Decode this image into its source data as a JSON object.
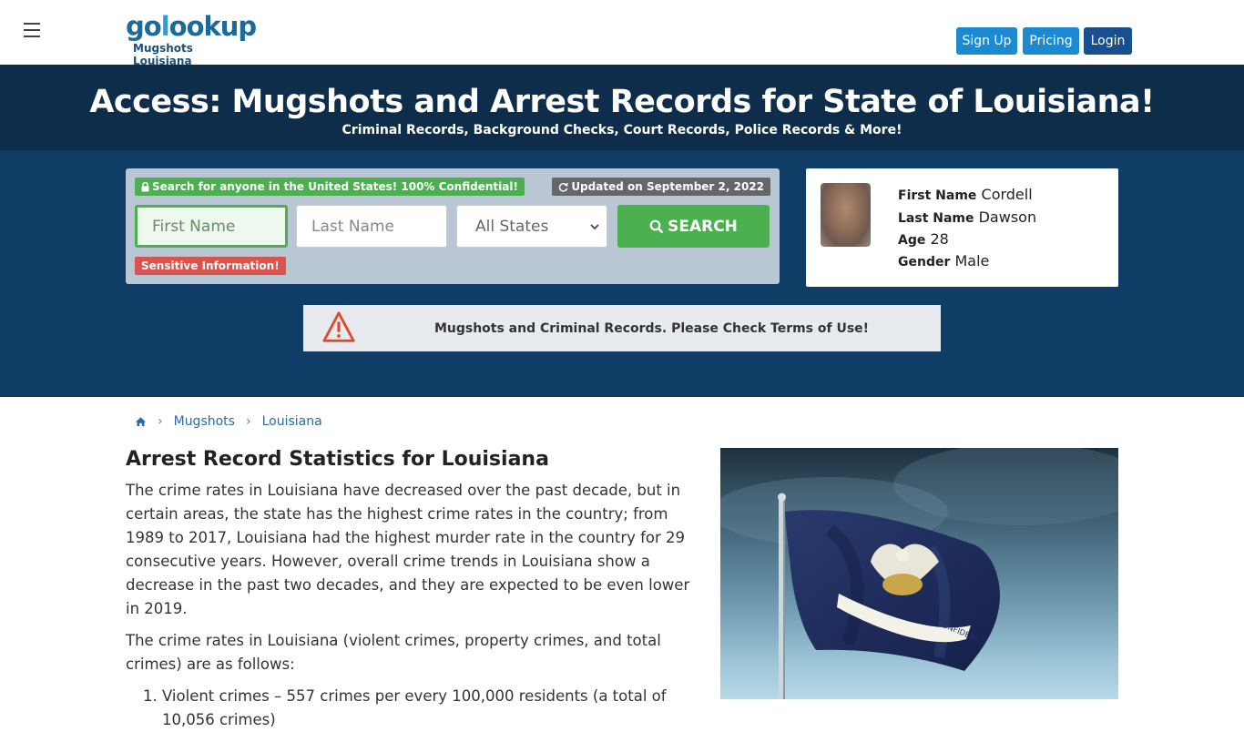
{
  "nav": {
    "logo_text": "golookup",
    "logo_subtitle": "Mugshots Louisiana",
    "signup_label": "Sign Up",
    "pricing_label": "Pricing",
    "login_label": "Login"
  },
  "hero": {
    "title": "Access: Mugshots and Arrest Records for State of Louisiana!",
    "subtitle": "Criminal Records, Background Checks, Court Records, Police Records & More!"
  },
  "search": {
    "confidential_badge": "Search for anyone in the United States! 100% Confidential!",
    "updated_badge": "Updated on September 2, 2022",
    "first_name_placeholder": "First Name",
    "last_name_placeholder": "Last Name",
    "state_selected": "All States",
    "search_button": "SEARCH",
    "sensitive_badge": "Sensitive Information!"
  },
  "profile": {
    "first_name_label": "First Name",
    "first_name": "Cordell",
    "last_name_label": "Last Name",
    "last_name": "Dawson",
    "age_label": "Age",
    "age": "28",
    "gender_label": "Gender",
    "gender": "Male"
  },
  "notice": {
    "text": "Mugshots and Criminal Records. Please Check Terms of Use!"
  },
  "breadcrumb": {
    "items": [
      "Mugshots",
      "Louisiana"
    ]
  },
  "article": {
    "heading": "Arrest Record Statistics for Louisiana",
    "paragraph1": "The crime rates in Louisiana have decreased over the past decade, but in certain areas, the state has the highest crime rates in the country; from 1989 to 2017, Louisiana had the highest murder rate in the country for 29 consecutive years. However, overall crime trends in Louisiana show a decrease in the past two decades, and they are expected to be even lower in 2019.",
    "paragraph2": "The crime rates in Louisiana (violent crimes, property crimes, and total crimes) are as follows:",
    "list": [
      "Violent crimes – 557 crimes per every 100,000 residents (a total of 10,056 crimes)"
    ]
  },
  "flag": {
    "banner_text": "UNION JUSTICE AND CONFIDENCE"
  },
  "colors": {
    "brand_blue": "#1c8ad0",
    "hero_dark": "#0d2d4a",
    "hero_body": "#103d66",
    "search_green": "#4caf50",
    "warning_red": "#d9534f"
  }
}
